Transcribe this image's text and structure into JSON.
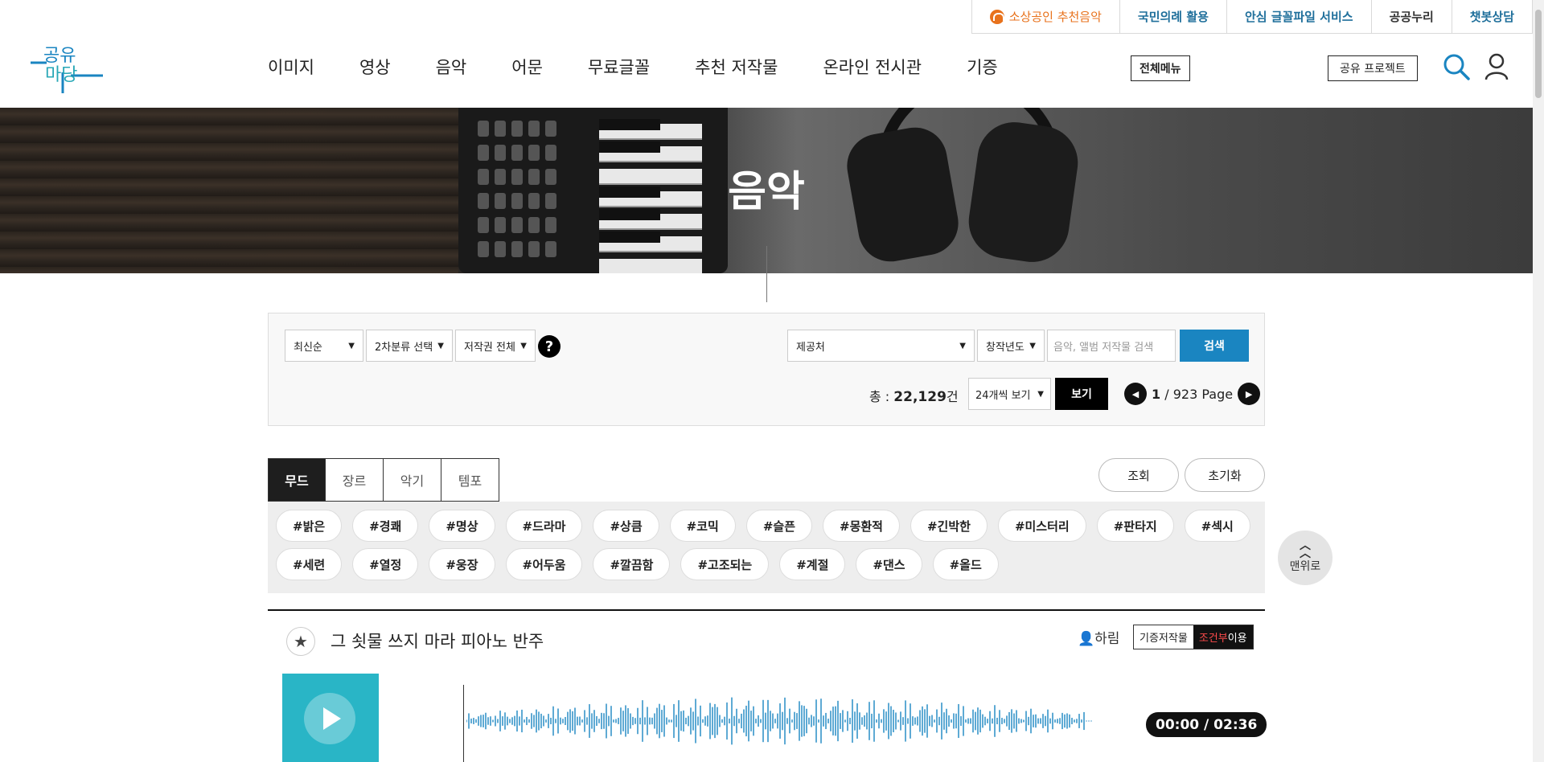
{
  "topbar": [
    {
      "label": "소상공인 추천음악",
      "style": "orange"
    },
    {
      "label": "국민의례 활용",
      "style": "blue"
    },
    {
      "label": "안심 글꼴파일 서비스",
      "style": "blue"
    },
    {
      "label": "공공누리",
      "style": "gray"
    },
    {
      "label": "챗봇상담",
      "style": "blue"
    }
  ],
  "logo": {
    "line1": "공유",
    "line2": "마당"
  },
  "nav": [
    "이미지",
    "영상",
    "음악",
    "어문",
    "무료글꼴",
    "추천 저작물",
    "온라인 전시관",
    "기증"
  ],
  "header": {
    "all_menu": "전체메뉴",
    "project": "공유 프로젝트"
  },
  "hero": {
    "title": "음악"
  },
  "filters": {
    "sort": "최신순",
    "category2": "2차분류 선택",
    "copyright": "저작권 전체",
    "help": "?",
    "provider": "제공처",
    "year": "창작년도",
    "keyword_placeholder": "음악, 앨범 저작물 검색",
    "search_button": "검색",
    "total_prefix": "총 : ",
    "total_count": "22,129",
    "total_suffix": "건",
    "per_page": "24개씩 보기",
    "view_button": "보기",
    "page_current": "1",
    "page_rest": " / 923 Page"
  },
  "tabs": [
    {
      "label": "무드",
      "active": true
    },
    {
      "label": "장르",
      "active": false
    },
    {
      "label": "악기",
      "active": false
    },
    {
      "label": "템포",
      "active": false
    }
  ],
  "actions": {
    "view": "조회",
    "reset": "초기화"
  },
  "tags_row1": [
    "#밝은",
    "#경쾌",
    "#명상",
    "#드라마",
    "#상큼",
    "#코믹",
    "#슬픈",
    "#몽환적",
    "#긴박한",
    "#미스터리",
    "#판타지",
    "#섹시"
  ],
  "tags_row2": [
    "#세련",
    "#열정",
    "#웅장",
    "#어두움",
    "#깔끔함",
    "#고조되는",
    "#계절",
    "#댄스",
    "#올드"
  ],
  "top_button": "맨위로",
  "track": {
    "title": "그 쇳물 쓰지 마라 피아노 반주",
    "artist": "하림",
    "badge_left": "기증저작물",
    "badge_red": "조건부",
    "badge_white": "이용",
    "time": "00:00 / 02:36"
  },
  "colors": {
    "accent": "#1a85c1",
    "orange": "#e8721c",
    "album": "#29b5c6"
  }
}
